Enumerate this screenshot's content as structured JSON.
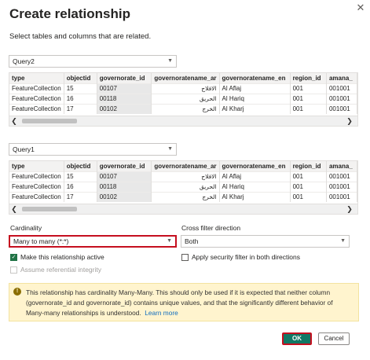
{
  "dialog": {
    "title": "Create relationship",
    "subtitle": "Select tables and columns that are related.",
    "close_label": "✕"
  },
  "table1": {
    "selected": "Query2",
    "columns": [
      "type",
      "objectid",
      "governorate_id",
      "governoratename_ar",
      "governoratename_en",
      "region_id",
      "amana_"
    ],
    "rows": [
      [
        "FeatureCollection",
        "15",
        "00107",
        "الافلاج",
        "Al Aflaj",
        "001",
        "001001"
      ],
      [
        "FeatureCollection",
        "16",
        "00118",
        "الحريق",
        "Al Hariq",
        "001",
        "001001"
      ],
      [
        "FeatureCollection",
        "17",
        "00102",
        "الخرج",
        "Al Kharj",
        "001",
        "001001"
      ]
    ],
    "selected_column": "governorate_id"
  },
  "table2": {
    "selected": "Query1",
    "columns": [
      "type",
      "objectid",
      "governorate_id",
      "governoratename_ar",
      "governoratename_en",
      "region_id",
      "amana_"
    ],
    "rows": [
      [
        "FeatureCollection",
        "15",
        "00107",
        "الافلاج",
        "Al Aflaj",
        "001",
        "001001"
      ],
      [
        "FeatureCollection",
        "16",
        "00118",
        "الحريق",
        "Al Hariq",
        "001",
        "001001"
      ],
      [
        "FeatureCollection",
        "17",
        "00102",
        "الخرج",
        "Al Kharj",
        "001",
        "001001"
      ]
    ],
    "selected_column": "governorate_id"
  },
  "cardinality": {
    "label": "Cardinality",
    "value": "Many to many (*:*)"
  },
  "cross_filter": {
    "label": "Cross filter direction",
    "value": "Both"
  },
  "options": {
    "make_active": {
      "label": "Make this relationship active",
      "checked": true
    },
    "security_filter": {
      "label": "Apply security filter in both directions",
      "checked": false
    },
    "referential_integrity": {
      "label": "Assume referential integrity",
      "checked": false,
      "disabled": true
    }
  },
  "warning": {
    "icon": "warning-icon",
    "text": "This relationship has cardinality Many-Many. This should only be used if it is expected that neither column (governorate_id and governorate_id) contains unique values, and that the significantly different behavior of Many-many relationships is understood.",
    "link": "Learn more"
  },
  "buttons": {
    "ok": "OK",
    "cancel": "Cancel"
  },
  "colors": {
    "accent": "#117865",
    "highlight_border": "#c50f1f",
    "warning_bg": "#fff4ce",
    "link": "#0f6cbd"
  }
}
